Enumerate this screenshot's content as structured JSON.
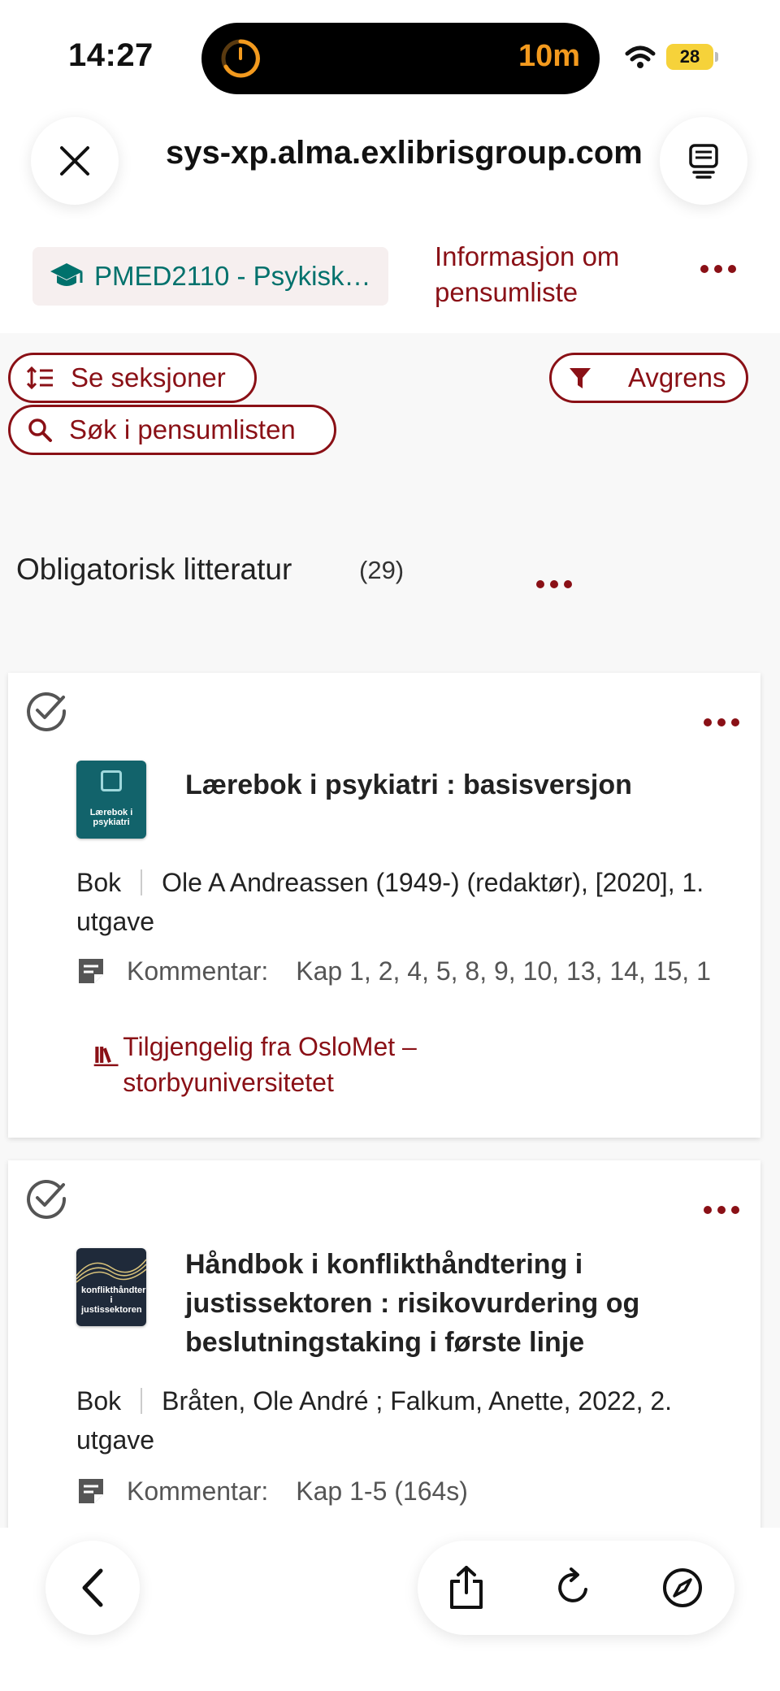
{
  "status_bar": {
    "time": "14:27",
    "activity_timer": "10m",
    "battery": "28"
  },
  "browser": {
    "url": "sys-xp.alma.exlibrisgroup.com"
  },
  "course": {
    "chip_label": "PMED2110 - Psykisk…",
    "info_link": "Informasjon om pensumliste"
  },
  "toolbar": {
    "sections_label": "Se seksjoner",
    "filter_label": "Avgrens",
    "search_label": "Søk i pensumlisten"
  },
  "section": {
    "title": "Obligatorisk litteratur",
    "count": "(29)"
  },
  "items": [
    {
      "title": "Lærebok i psykiatri : basisversjon",
      "cover_text": "Lærebok i psykiatri",
      "type": "Bok",
      "details": "Ole A Andreassen (1949-) (redaktør), [2020], 1. utgave",
      "comment_label": "Kommentar:",
      "comment": "Kap 1, 2, 4, 5, 8, 9, 10, 13, 14, 15, 1",
      "availability": "Tilgjengelig fra OsloMet – storbyuniversitetet"
    },
    {
      "title": "Håndbok i konflikthåndtering i justissektoren : risikovurdering og beslutningstaking i første linje",
      "cover_text": "konflikthåndtering i justissektoren",
      "type": "Bok",
      "details": "Bråten, Ole André ; Falkum, Anette, 2022, 2. utgave",
      "comment_label": "Kommentar:",
      "comment": "Kap 1-5 (164s)"
    }
  ],
  "colors": {
    "accent": "#8a1016",
    "teal": "#00716c",
    "timer": "#f39a1e",
    "battery": "#f6d23a"
  },
  "icons": [
    "close-icon",
    "tabs-icon",
    "graduation-cap-icon",
    "sort-icon",
    "filter-icon",
    "search-icon",
    "check-circle-icon",
    "comment-icon",
    "library-icon",
    "back-icon",
    "share-icon",
    "reload-icon",
    "compass-icon"
  ]
}
